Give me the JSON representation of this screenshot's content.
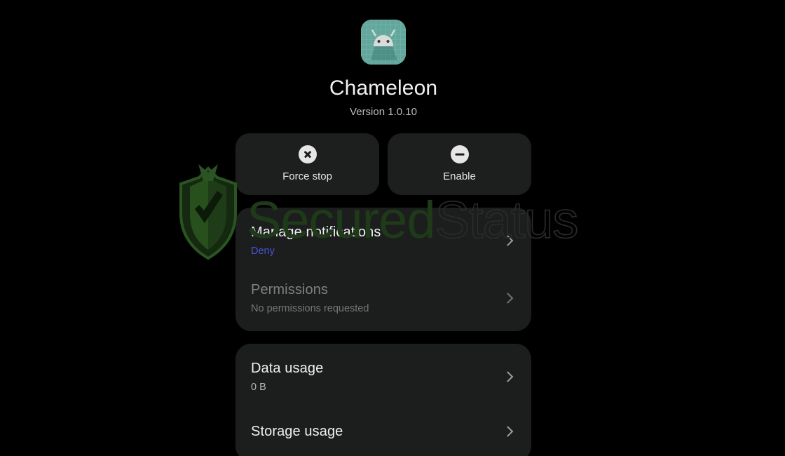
{
  "theme": {
    "background": "#000000",
    "card_background": "#1c1e1e",
    "button_background": "#1d1f1f",
    "primary_text": "#f0f0f0",
    "secondary_text": "#b6b9bb",
    "disabled_text": "#7d8183",
    "accent_blue": "#4a52d6",
    "icon_background": "#63a79c",
    "watermark_green": "#1f3a19",
    "watermark_gray": "#2a2c2c"
  },
  "app_header": {
    "icon_name": "android-robot-app-icon",
    "title": "Chameleon",
    "version": "Version 1.0.10"
  },
  "actions": [
    {
      "label": "Force stop",
      "icon": "close-circle-icon",
      "icon_class": "x-icon",
      "name": "force-stop-button"
    },
    {
      "label": "Enable",
      "icon": "minus-circle-icon",
      "icon_class": "minus-icon",
      "name": "enable-button"
    }
  ],
  "cards": [
    {
      "name": "notifications-permissions-card",
      "rows": [
        {
          "name": "manage-notifications-row",
          "title": "Manage notifications",
          "subtitle": "Deny",
          "subtitle_style": "accent",
          "disabled": false
        },
        {
          "name": "permissions-row",
          "title": "Permissions",
          "subtitle": "No permissions requested",
          "subtitle_style": "normal",
          "disabled": true
        }
      ]
    },
    {
      "name": "usage-card",
      "rows": [
        {
          "name": "data-usage-row",
          "title": "Data usage",
          "subtitle": "0 B",
          "subtitle_style": "normal",
          "disabled": false
        },
        {
          "name": "storage-usage-row",
          "title": "Storage usage",
          "subtitle": "",
          "subtitle_style": "normal",
          "disabled": false
        }
      ]
    }
  ],
  "watermark": {
    "shield_icon": "shield-check-logo",
    "text_primary": "Secured",
    "text_secondary": "Status"
  }
}
